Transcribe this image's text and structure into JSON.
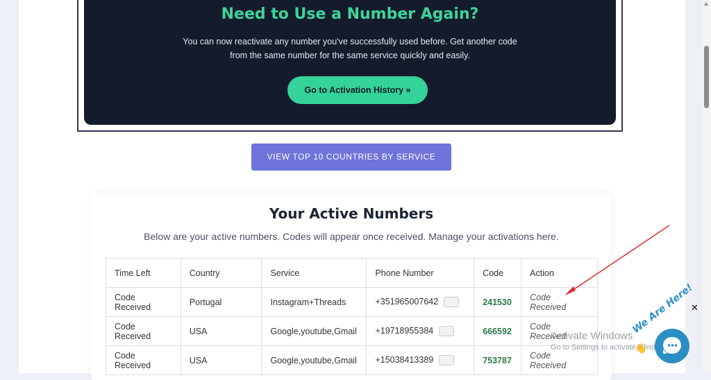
{
  "promo": {
    "title": "Need to Use a Number Again?",
    "text": "You can now reactivate any number you've successfully used before. Get another code from the same number for the same service quickly and easily.",
    "button_label": "Go to Activation History »"
  },
  "top10_button_label": "VIEW TOP 10 COUNTRIES BY SERVICE",
  "active": {
    "title": "Your Active Numbers",
    "subtitle": "Below are your active numbers. Codes will appear once received. Manage your activations here.",
    "columns": [
      "Time Left",
      "Country",
      "Service",
      "Phone Number",
      "Code",
      "Action"
    ],
    "rows": [
      {
        "time_left": "Code Received",
        "country": "Portugal",
        "service": "Instagram+Threads",
        "phone": "+351965007642",
        "code": "241530",
        "action": "Code Received"
      },
      {
        "time_left": "Code Received",
        "country": "USA",
        "service": "Google,youtube,Gmail",
        "phone": "+19718955384",
        "code": "666592",
        "action": "Code Received"
      },
      {
        "time_left": "Code Received",
        "country": "USA",
        "service": "Google,youtube,Gmail",
        "phone": "+15038413389",
        "code": "753787",
        "action": "Code Received"
      }
    ]
  },
  "overlay": {
    "watermark_line1": "Activate Windows",
    "watermark_line2": "Go to Settings to activate Windows.",
    "close_glyph": "✕",
    "chat_badge": "We Are Here!",
    "wave_glyph": "👋"
  },
  "colors": {
    "promo_bg": "#141b2b",
    "accent_green": "#34d399",
    "button_purple": "#6e74d9",
    "code_green": "#2b7a4b",
    "annotation_red": "#e0282e",
    "chat_blue": "#2b8ec4"
  }
}
